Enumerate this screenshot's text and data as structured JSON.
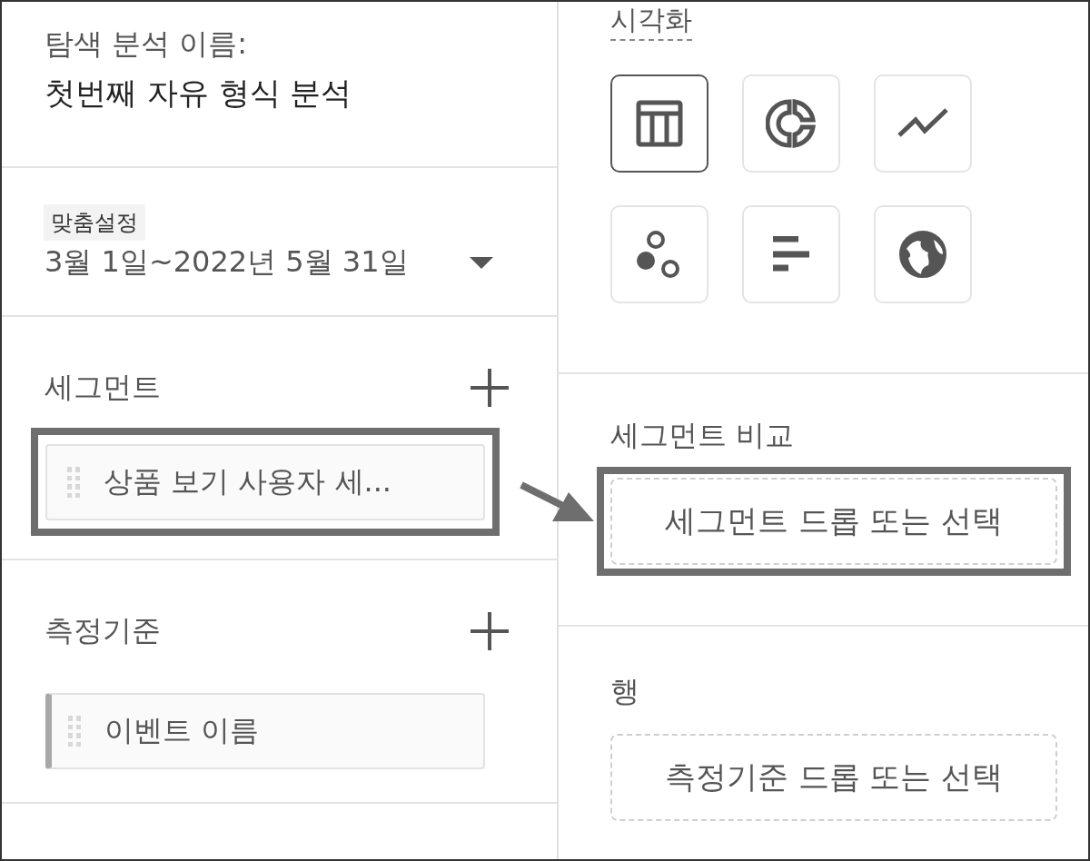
{
  "analysis_name": {
    "label": "탐색 분석 이름:",
    "value": "첫번째 자유 형식 분석"
  },
  "date_range": {
    "badge": "맞춤설정",
    "value": "3월 1일~2022년 5월 31일"
  },
  "segments": {
    "title": "세그먼트",
    "items": [
      {
        "label": "상품 보기 사용자 세...",
        "accent": false,
        "highlighted": true
      }
    ]
  },
  "metrics": {
    "title": "측정기준",
    "items": [
      {
        "label": "이벤트 이름",
        "accent": true,
        "highlighted": false
      }
    ]
  },
  "visualization": {
    "title": "시각화",
    "options": [
      {
        "kind": "table",
        "selected": true
      },
      {
        "kind": "donut",
        "selected": false
      },
      {
        "kind": "line",
        "selected": false
      },
      {
        "kind": "scatter",
        "selected": false
      },
      {
        "kind": "bar",
        "selected": false
      },
      {
        "kind": "geo",
        "selected": false
      }
    ]
  },
  "segment_comparison": {
    "title": "세그먼트 비교",
    "placeholder": "세그먼트 드롭 또는 선택",
    "highlighted": true
  },
  "rows": {
    "title": "행",
    "placeholder": "측정기준 드롭 또는 선택",
    "highlighted": false
  },
  "annotation_arrow": true
}
